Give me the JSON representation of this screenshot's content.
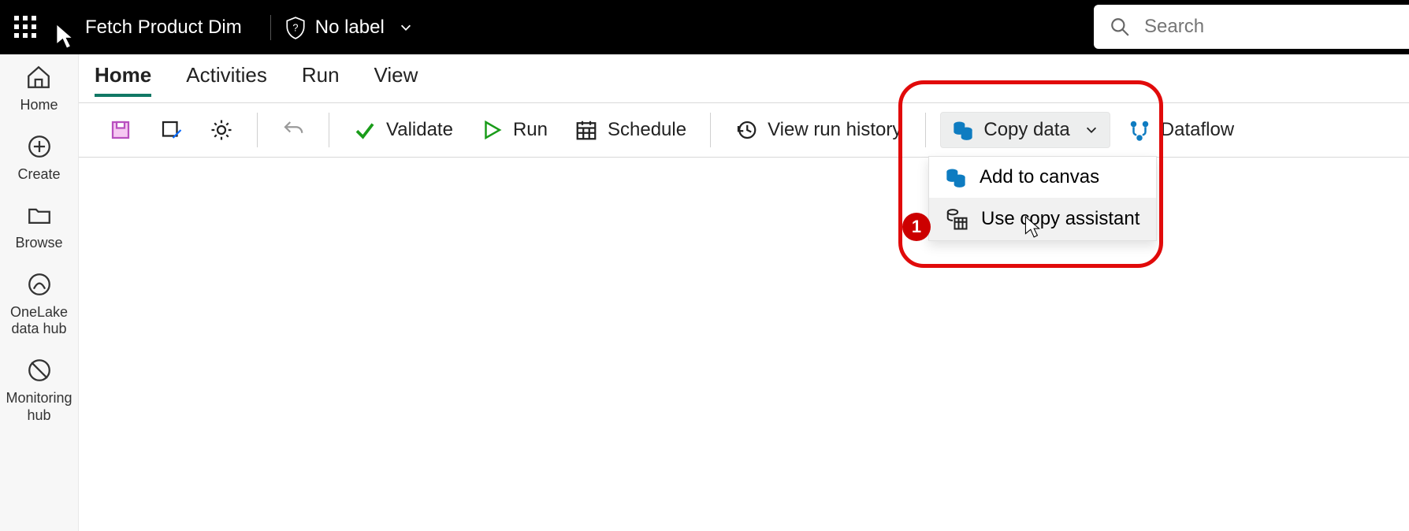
{
  "top": {
    "title": "Fetch Product Dim",
    "label_dropdown": "No label",
    "search_placeholder": "Search"
  },
  "leftnav": {
    "items": [
      {
        "label": "Home"
      },
      {
        "label": "Create"
      },
      {
        "label": "Browse"
      },
      {
        "label": "OneLake data hub"
      },
      {
        "label": "Monitoring hub"
      }
    ]
  },
  "tabs": {
    "items": [
      "Home",
      "Activities",
      "Run",
      "View"
    ],
    "active": "Home"
  },
  "toolbar": {
    "validate": "Validate",
    "run": "Run",
    "schedule": "Schedule",
    "view_history": "View run history",
    "copy_data": "Copy data",
    "dataflow": "Dataflow"
  },
  "dropdown": {
    "add_to_canvas": "Add to canvas",
    "use_copy_assistant": "Use copy assistant"
  },
  "annotation": {
    "badge": "1"
  }
}
